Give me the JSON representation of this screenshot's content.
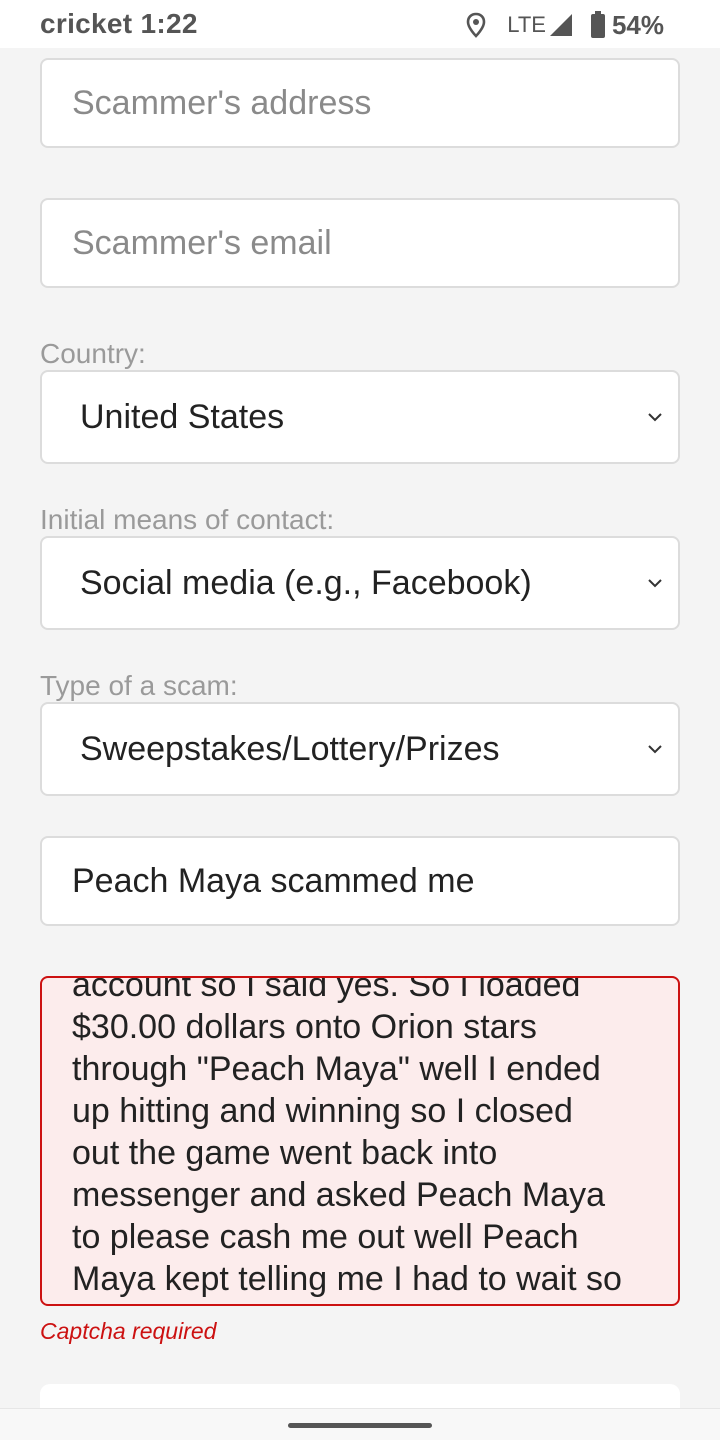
{
  "status_bar": {
    "carrier_time": "cricket 1:22",
    "network": "LTE",
    "battery": "54%"
  },
  "form": {
    "scammer_address": {
      "placeholder": "Scammer's address",
      "value": ""
    },
    "scammer_email": {
      "placeholder": "Scammer's email",
      "value": ""
    },
    "country": {
      "label": "Country:",
      "selected": "United States"
    },
    "contact_means": {
      "label": "Initial means of contact:",
      "selected": "Social media (e.g., Facebook)"
    },
    "scam_type": {
      "label": "Type of a scam:",
      "selected": "Sweepstakes/Lottery/Prizes"
    },
    "scammer_name": {
      "value": "Peach Maya scammed me"
    },
    "description": {
      "lines": [
        "account so I said yes. So I loaded",
        "$30.00 dollars onto Orion stars",
        "through \"Peach Maya\" well I ended",
        "up hitting and winning so I closed",
        "out the game went back into",
        "messenger and asked Peach Maya",
        "to please cash me out well Peach",
        "Maya kept telling me I had to wait so"
      ]
    },
    "captcha_error": "Captcha required"
  },
  "colors": {
    "error": "#cc1111",
    "error_background": "#fcecec",
    "page_background": "#f4f4f4"
  },
  "icons": [
    "location-icon",
    "signal-icon",
    "battery-icon",
    "chevron-down-icon"
  ]
}
